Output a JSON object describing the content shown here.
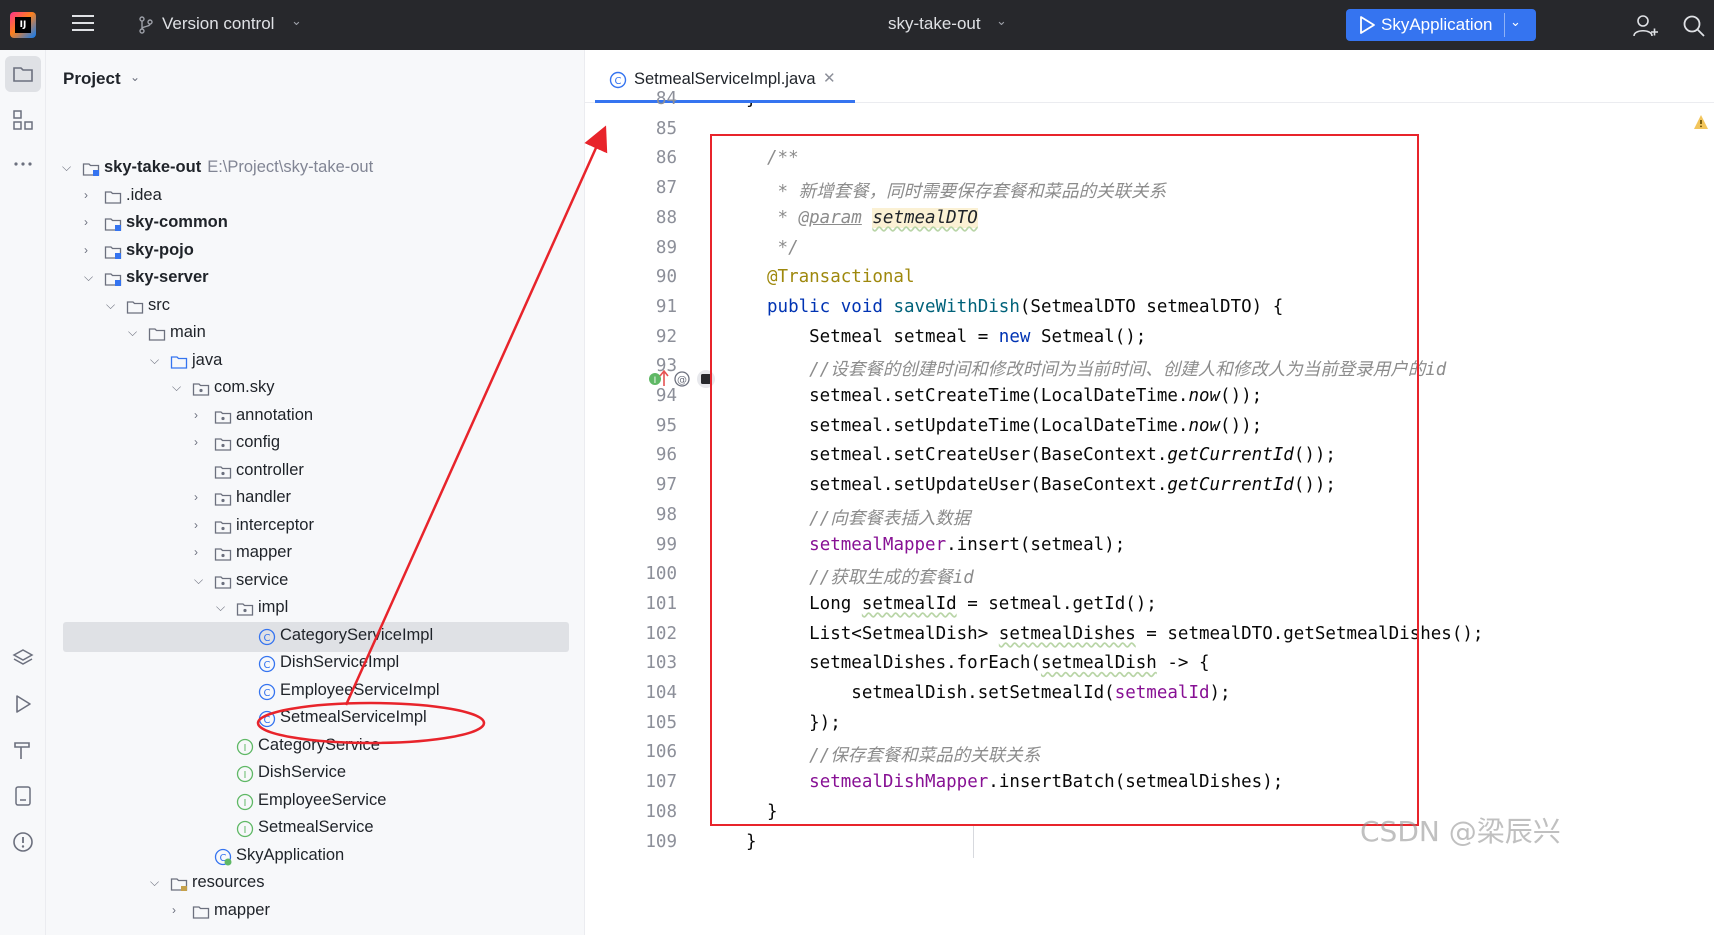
{
  "topbar": {
    "version_control": "Version control",
    "project_name": "sky-take-out",
    "run_config": "SkyApplication"
  },
  "panel": {
    "title": "Project"
  },
  "tree": [
    {
      "level": 0,
      "expanded": true,
      "icon": "module",
      "label": "sky-take-out",
      "bold": true,
      "path": "E:\\Project\\sky-take-out"
    },
    {
      "level": 1,
      "expanded": false,
      "icon": "folder",
      "label": ".idea"
    },
    {
      "level": 1,
      "expanded": false,
      "icon": "module",
      "label": "sky-common",
      "bold": true
    },
    {
      "level": 1,
      "expanded": false,
      "icon": "module",
      "label": "sky-pojo",
      "bold": true
    },
    {
      "level": 1,
      "expanded": true,
      "icon": "module",
      "label": "sky-server",
      "bold": true
    },
    {
      "level": 2,
      "expanded": true,
      "icon": "folder",
      "label": "src"
    },
    {
      "level": 3,
      "expanded": true,
      "icon": "folder",
      "label": "main"
    },
    {
      "level": 4,
      "expanded": true,
      "icon": "source-folder",
      "label": "java"
    },
    {
      "level": 5,
      "expanded": true,
      "icon": "package",
      "label": "com.sky"
    },
    {
      "level": 6,
      "expanded": false,
      "icon": "package",
      "label": "annotation"
    },
    {
      "level": 6,
      "expanded": false,
      "icon": "package",
      "label": "config"
    },
    {
      "level": 6,
      "expanded": null,
      "icon": "package",
      "label": "controller"
    },
    {
      "level": 6,
      "expanded": false,
      "icon": "package",
      "label": "handler"
    },
    {
      "level": 6,
      "expanded": false,
      "icon": "package",
      "label": "interceptor"
    },
    {
      "level": 6,
      "expanded": false,
      "icon": "package",
      "label": "mapper"
    },
    {
      "level": 6,
      "expanded": true,
      "icon": "package",
      "label": "service"
    },
    {
      "level": 7,
      "expanded": true,
      "icon": "package",
      "label": "impl"
    },
    {
      "level": 8,
      "expanded": null,
      "icon": "class",
      "label": "CategoryServiceImpl",
      "selected": true
    },
    {
      "level": 8,
      "expanded": null,
      "icon": "class",
      "label": "DishServiceImpl"
    },
    {
      "level": 8,
      "expanded": null,
      "icon": "class",
      "label": "EmployeeServiceImpl"
    },
    {
      "level": 8,
      "expanded": null,
      "icon": "class",
      "label": "SetmealServiceImpl",
      "circled": true
    },
    {
      "level": 7,
      "expanded": null,
      "icon": "interface",
      "label": "CategoryService"
    },
    {
      "level": 7,
      "expanded": null,
      "icon": "interface",
      "label": "DishService"
    },
    {
      "level": 7,
      "expanded": null,
      "icon": "interface",
      "label": "EmployeeService"
    },
    {
      "level": 7,
      "expanded": null,
      "icon": "interface",
      "label": "SetmealService"
    },
    {
      "level": 6,
      "expanded": null,
      "icon": "spring-class",
      "label": "SkyApplication"
    },
    {
      "level": 4,
      "expanded": true,
      "icon": "resources-folder",
      "label": "resources"
    },
    {
      "level": 5,
      "expanded": false,
      "icon": "folder",
      "label": "mapper"
    }
  ],
  "editor": {
    "tab_name": "SetmealServiceImpl.java",
    "line_numbers": [
      "84",
      "85",
      "86",
      "87",
      "88",
      "89",
      "90",
      "91",
      "92",
      "93",
      "94",
      "95",
      "96",
      "97",
      "98",
      "99",
      "100",
      "101",
      "102",
      "103",
      "104",
      "105",
      "106",
      "107",
      "108",
      "109"
    ],
    "code": [
      [
        {
          "t": "}",
          "c": ""
        }
      ],
      [],
      [
        {
          "t": "/**",
          "c": "cmt"
        }
      ],
      [
        {
          "t": " * 新增套餐，同时需要保存套餐和菜品的关联关系",
          "c": "cmt"
        }
      ],
      [
        {
          "t": " * ",
          "c": "cmt"
        },
        {
          "t": "@param",
          "c": "tag"
        },
        {
          "t": " ",
          "c": "cmt"
        },
        {
          "t": "setmealDTO",
          "c": "prm"
        }
      ],
      [
        {
          "t": " */",
          "c": "cmt"
        }
      ],
      [
        {
          "t": "@Transactional",
          "c": "ann"
        }
      ],
      [
        {
          "t": "public void ",
          "c": "kw"
        },
        {
          "t": "saveWithDish",
          "c": "fn"
        },
        {
          "t": "(SetmealDTO setmealDTO) {",
          "c": ""
        }
      ],
      [
        {
          "t": "    Setmeal setmeal = ",
          "c": ""
        },
        {
          "t": "new",
          "c": "kw"
        },
        {
          "t": " Setmeal();",
          "c": ""
        }
      ],
      [
        {
          "t": "    //设套餐的创建时间和修改时间为当前时间、创建人和修改人为当前登录用户的id",
          "c": "cmt"
        }
      ],
      [
        {
          "t": "    setmeal.setCreateTime(LocalDateTime.",
          "c": ""
        },
        {
          "t": "now",
          "c": "it"
        },
        {
          "t": "());",
          "c": ""
        }
      ],
      [
        {
          "t": "    setmeal.setUpdateTime(LocalDateTime.",
          "c": ""
        },
        {
          "t": "now",
          "c": "it"
        },
        {
          "t": "());",
          "c": ""
        }
      ],
      [
        {
          "t": "    setmeal.setCreateUser(BaseContext.",
          "c": ""
        },
        {
          "t": "getCurrentId",
          "c": "it"
        },
        {
          "t": "());",
          "c": ""
        }
      ],
      [
        {
          "t": "    setmeal.setUpdateUser(BaseContext.",
          "c": ""
        },
        {
          "t": "getCurrentId",
          "c": "it"
        },
        {
          "t": "());",
          "c": ""
        }
      ],
      [
        {
          "t": "    //向套餐表插入数据",
          "c": "cmt"
        }
      ],
      [
        {
          "t": "    ",
          "c": ""
        },
        {
          "t": "setmealMapper",
          "c": "fld"
        },
        {
          "t": ".insert(setmeal);",
          "c": ""
        }
      ],
      [
        {
          "t": "    //获取生成的套餐id",
          "c": "cmt"
        }
      ],
      [
        {
          "t": "    Long ",
          "c": ""
        },
        {
          "t": "setmealId",
          "c": "wav"
        },
        {
          "t": " = setmeal.getId();",
          "c": ""
        }
      ],
      [
        {
          "t": "    List<SetmealDish> ",
          "c": ""
        },
        {
          "t": "setmealDishes",
          "c": "wav"
        },
        {
          "t": " = setmealDTO.getSetmealDishes();",
          "c": ""
        }
      ],
      [
        {
          "t": "    setmealDishes.forEach(",
          "c": ""
        },
        {
          "t": "setmealDish",
          "c": "wav"
        },
        {
          "t": " -> {",
          "c": ""
        }
      ],
      [
        {
          "t": "        setmealDish.setSetmealId(",
          "c": ""
        },
        {
          "t": "setmealId",
          "c": "fld"
        },
        {
          "t": ");",
          "c": ""
        }
      ],
      [
        {
          "t": "    });",
          "c": ""
        }
      ],
      [
        {
          "t": "    //保存套餐和菜品的关联关系",
          "c": "cmt"
        }
      ],
      [
        {
          "t": "    ",
          "c": ""
        },
        {
          "t": "setmealDishMapper",
          "c": "fld"
        },
        {
          "t": ".insertBatch(setmealDishes);",
          "c": ""
        }
      ],
      [
        {
          "t": "}",
          "c": ""
        }
      ],
      [
        {
          "t": "}",
          "c": ""
        }
      ]
    ]
  },
  "watermark": "CSDN @梁辰兴",
  "colors": {
    "accent": "#3574f0",
    "annotation_red": "#e8242b",
    "topbar": "#27282c"
  }
}
